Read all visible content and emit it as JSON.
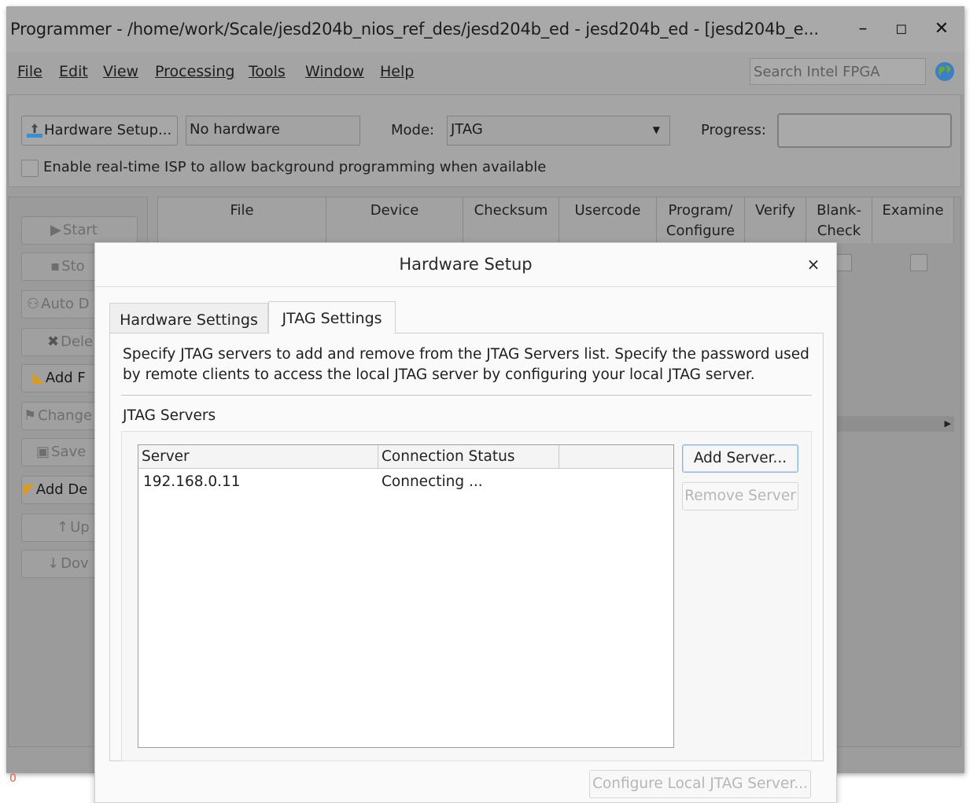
{
  "window": {
    "title": "Programmer - /home/work/Scale/jesd204b_nios_ref_des/jesd204b_ed - jesd204b_ed - [jesd204b_e...",
    "minimize": "–",
    "maximize": "◻",
    "close": "✕"
  },
  "menu": [
    "File",
    "Edit",
    "View",
    "Processing",
    "Tools",
    "Window",
    "Help"
  ],
  "search": {
    "placeholder": "Search Intel FPGA"
  },
  "toolbar": {
    "hardware_setup_label": "Hardware Setup...",
    "hardware_value": "No hardware",
    "mode_label": "Mode:",
    "mode_value": "JTAG",
    "progress_label": "Progress:",
    "isp_label": "Enable real-time ISP to allow background programming when available"
  },
  "side_buttons": [
    {
      "label": "Start",
      "enabled": false
    },
    {
      "label": "Sto",
      "enabled": false
    },
    {
      "label": "Auto D",
      "enabled": false
    },
    {
      "label": "Dele",
      "enabled": false
    },
    {
      "label": "Add F",
      "enabled": true
    },
    {
      "label": "Change",
      "enabled": false
    },
    {
      "label": "Save",
      "enabled": false
    },
    {
      "label": "Add De",
      "enabled": true
    },
    {
      "label": "Up",
      "enabled": false
    },
    {
      "label": "Dov",
      "enabled": false
    }
  ],
  "grid_columns": [
    "File",
    "Device",
    "Checksum",
    "Usercode",
    "Program/\nConfigure",
    "Verify",
    "Blank-\nCheck",
    "Examine"
  ],
  "status_indicator": "0",
  "dialog": {
    "title": "Hardware Setup",
    "close": "×",
    "tabs": [
      "Hardware Settings",
      "JTAG Settings"
    ],
    "description": "Specify JTAG servers to add and remove from the JTAG Servers list. Specify the password used by remote clients to access the local JTAG server by configuring your local JTAG server.",
    "group_title": "JTAG Servers",
    "table": {
      "headers": [
        "Server",
        "Connection Status"
      ],
      "rows": [
        [
          "192.168.0.11",
          "Connecting ..."
        ]
      ]
    },
    "add_server": "Add Server...",
    "remove_server": "Remove Server",
    "configure_local": "Configure Local JTAG Server..."
  },
  "colors": {
    "window_bg": "#9d9d9d",
    "dialog_bg": "#fafafa",
    "focus_border": "#8fb4d8",
    "status_red": "#e25a4a"
  }
}
